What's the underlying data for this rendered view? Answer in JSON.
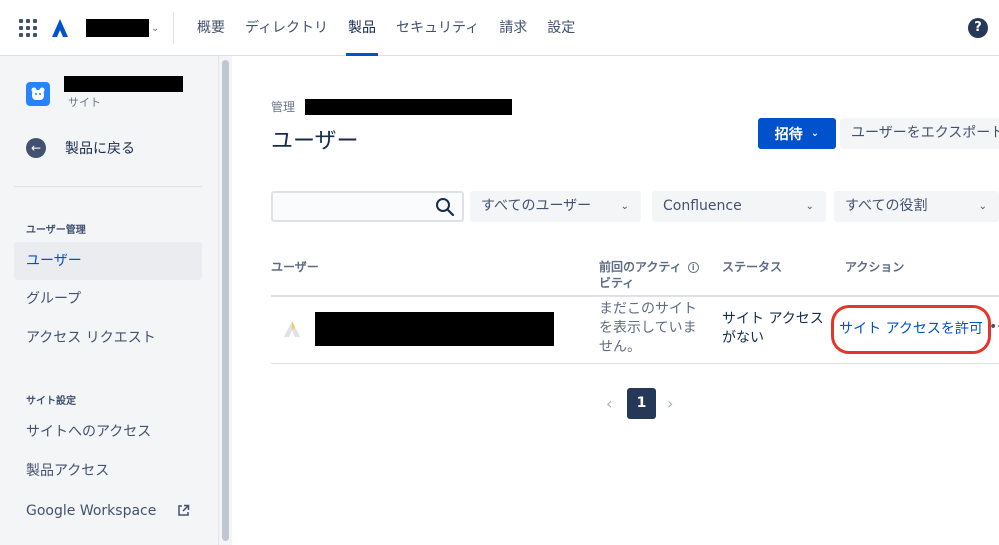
{
  "nav": {
    "items": [
      {
        "label": "概要",
        "active": false
      },
      {
        "label": "ディレクトリ",
        "active": false
      },
      {
        "label": "製品",
        "active": true
      },
      {
        "label": "セキュリティ",
        "active": false
      },
      {
        "label": "請求",
        "active": false
      },
      {
        "label": "設定",
        "active": false
      }
    ],
    "help_label": "?",
    "accent": "#0052cc"
  },
  "sidebar": {
    "site_subtitle": "サイト",
    "back_label": "製品に戻る",
    "section_users": "ユーザー管理",
    "items_users": [
      "ユーザー",
      "グループ",
      "アクセス リクエスト"
    ],
    "section_site": "サイト設定",
    "items_site": [
      "サイトへのアクセス",
      "製品アクセス",
      "Google Workspace"
    ]
  },
  "main": {
    "breadcrumb": "管理",
    "title": "ユーザー",
    "invite_label": "招待",
    "export_label": "ユーザーをエクスポート",
    "search": {
      "value": "",
      "placeholder": ""
    },
    "filters": [
      "すべてのユーザー",
      "Confluence",
      "すべての役割"
    ],
    "table": {
      "headers": {
        "user": "ユーザー",
        "last_activity": "前回のアクティビティ",
        "last_activity_line1": "前回のアクティ",
        "last_activity_line2": "ビティ",
        "status": "ステータス",
        "actions": "アクション"
      },
      "rows": [
        {
          "activity_line1": "まだこのサイト",
          "activity_line2": "を表示していま",
          "activity_line3": "せん。",
          "status_line1": "サイト アクセス",
          "status_line2": "がない",
          "action": "サイト アクセスを許可",
          "more": "••"
        }
      ]
    },
    "pagination": {
      "current": "1",
      "prev": "‹",
      "next": "›"
    },
    "highlight_color": "#e53528"
  }
}
